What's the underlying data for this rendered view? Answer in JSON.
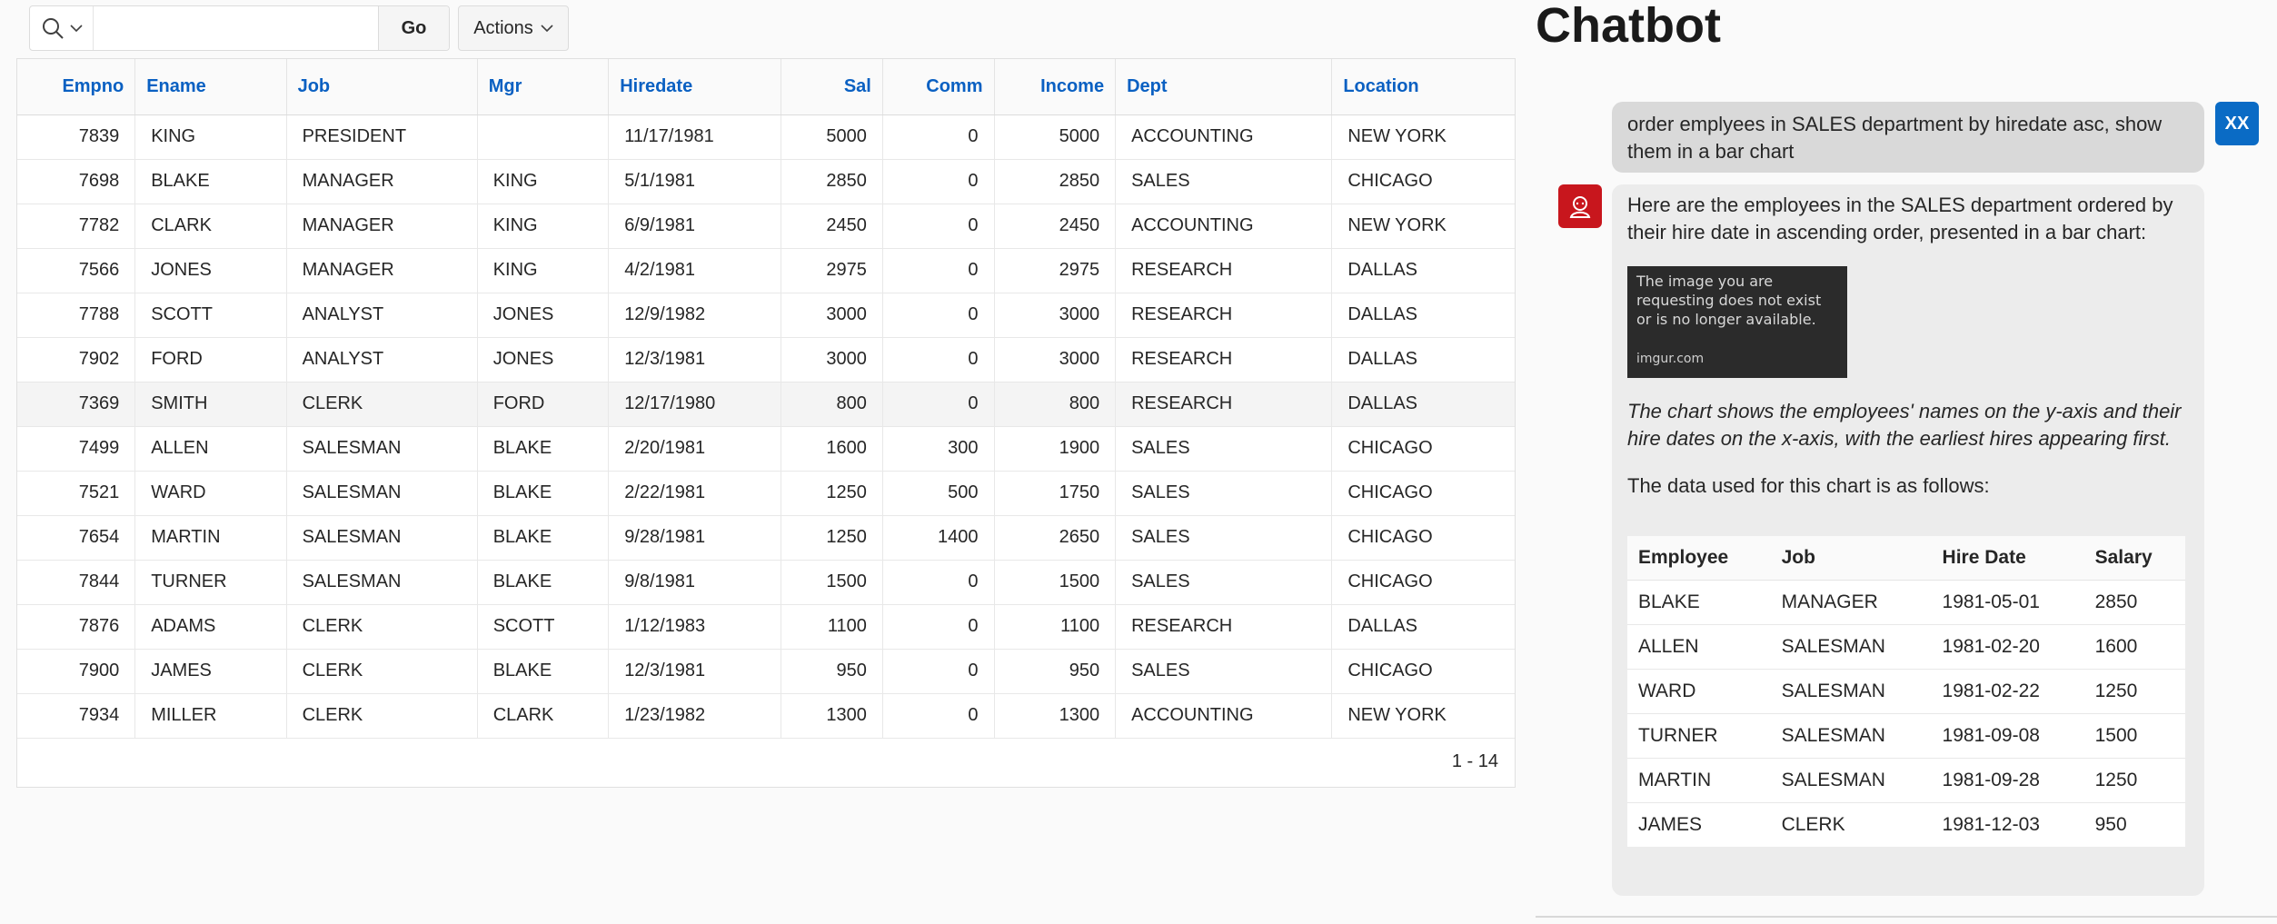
{
  "toolbar": {
    "search_placeholder": "",
    "go_label": "Go",
    "actions_label": "Actions"
  },
  "grid": {
    "columns": [
      {
        "label": "Empno",
        "align": "right"
      },
      {
        "label": "Ename",
        "align": "left"
      },
      {
        "label": "Job",
        "align": "left"
      },
      {
        "label": "Mgr",
        "align": "left"
      },
      {
        "label": "Hiredate",
        "align": "left"
      },
      {
        "label": "Sal",
        "align": "right"
      },
      {
        "label": "Comm",
        "align": "right"
      },
      {
        "label": "Income",
        "align": "right"
      },
      {
        "label": "Dept",
        "align": "left"
      },
      {
        "label": "Location",
        "align": "left"
      }
    ],
    "rows": [
      [
        "7839",
        "KING",
        "PRESIDENT",
        "",
        "11/17/1981",
        "5000",
        "0",
        "5000",
        "ACCOUNTING",
        "NEW YORK"
      ],
      [
        "7698",
        "BLAKE",
        "MANAGER",
        "KING",
        "5/1/1981",
        "2850",
        "0",
        "2850",
        "SALES",
        "CHICAGO"
      ],
      [
        "7782",
        "CLARK",
        "MANAGER",
        "KING",
        "6/9/1981",
        "2450",
        "0",
        "2450",
        "ACCOUNTING",
        "NEW YORK"
      ],
      [
        "7566",
        "JONES",
        "MANAGER",
        "KING",
        "4/2/1981",
        "2975",
        "0",
        "2975",
        "RESEARCH",
        "DALLAS"
      ],
      [
        "7788",
        "SCOTT",
        "ANALYST",
        "JONES",
        "12/9/1982",
        "3000",
        "0",
        "3000",
        "RESEARCH",
        "DALLAS"
      ],
      [
        "7902",
        "FORD",
        "ANALYST",
        "JONES",
        "12/3/1981",
        "3000",
        "0",
        "3000",
        "RESEARCH",
        "DALLAS"
      ],
      [
        "7369",
        "SMITH",
        "CLERK",
        "FORD",
        "12/17/1980",
        "800",
        "0",
        "800",
        "RESEARCH",
        "DALLAS"
      ],
      [
        "7499",
        "ALLEN",
        "SALESMAN",
        "BLAKE",
        "2/20/1981",
        "1600",
        "300",
        "1900",
        "SALES",
        "CHICAGO"
      ],
      [
        "7521",
        "WARD",
        "SALESMAN",
        "BLAKE",
        "2/22/1981",
        "1250",
        "500",
        "1750",
        "SALES",
        "CHICAGO"
      ],
      [
        "7654",
        "MARTIN",
        "SALESMAN",
        "BLAKE",
        "9/28/1981",
        "1250",
        "1400",
        "2650",
        "SALES",
        "CHICAGO"
      ],
      [
        "7844",
        "TURNER",
        "SALESMAN",
        "BLAKE",
        "9/8/1981",
        "1500",
        "0",
        "1500",
        "SALES",
        "CHICAGO"
      ],
      [
        "7876",
        "ADAMS",
        "CLERK",
        "SCOTT",
        "1/12/1983",
        "1100",
        "0",
        "1100",
        "RESEARCH",
        "DALLAS"
      ],
      [
        "7900",
        "JAMES",
        "CLERK",
        "BLAKE",
        "12/3/1981",
        "950",
        "0",
        "950",
        "SALES",
        "CHICAGO"
      ],
      [
        "7934",
        "MILLER",
        "CLERK",
        "CLARK",
        "1/23/1982",
        "1300",
        "0",
        "1300",
        "ACCOUNTING",
        "NEW YORK"
      ]
    ],
    "highlighted_row_index": 6,
    "pagination": "1 - 14"
  },
  "chatbot": {
    "title": "Chatbot",
    "user_avatar": "XX",
    "user_message": "order emplyees in SALES department by hiredate asc, show them in a bar chart",
    "bot_intro": "Here are the employees in the SALES department ordered by their hire date in ascending order, presented in a bar chart:",
    "broken_image_text": "The image you are requesting does not exist or is no longer available.",
    "broken_image_brand": "imgur.com",
    "caption": "The chart shows the employees' names on the y-axis and their hire dates on the x-axis, with the earliest hires appearing first.",
    "data_intro": "The data used for this chart is as follows:",
    "table": {
      "headers": [
        "Employee",
        "Job",
        "Hire Date",
        "Salary"
      ],
      "rows": [
        [
          "BLAKE",
          "MANAGER",
          "1981-05-01",
          "2850"
        ],
        [
          "ALLEN",
          "SALESMAN",
          "1981-02-20",
          "1600"
        ],
        [
          "WARD",
          "SALESMAN",
          "1981-02-22",
          "1250"
        ],
        [
          "TURNER",
          "SALESMAN",
          "1981-09-08",
          "1500"
        ],
        [
          "MARTIN",
          "SALESMAN",
          "1981-09-28",
          "1250"
        ],
        [
          "JAMES",
          "CLERK",
          "1981-12-03",
          "950"
        ]
      ]
    }
  },
  "colors": {
    "header_link": "#0a60c2",
    "user_avatar_bg": "#0a6bc5",
    "bot_avatar_bg": "#c8161d"
  },
  "icons": {
    "search": "search-icon",
    "chevron": "chevron-down-icon",
    "bot": "bot-icon"
  }
}
